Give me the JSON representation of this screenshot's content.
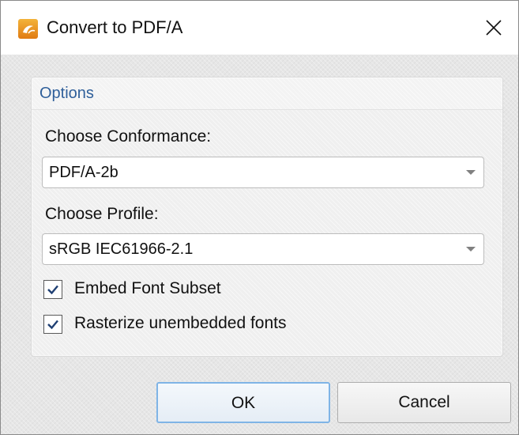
{
  "window": {
    "title": "Convert to PDF/A",
    "app_icon": "pdf-app-icon",
    "close_icon": "close-icon"
  },
  "options": {
    "group_title": "Options",
    "conformance_label": "Choose Conformance:",
    "conformance_value": "PDF/A-2b",
    "profile_label": "Choose Profile:",
    "profile_value": "sRGB IEC61966-2.1",
    "embed_font_subset_label": "Embed Font Subset",
    "embed_font_subset_checked": true,
    "rasterize_label": "Rasterize unembedded fonts",
    "rasterize_checked": true
  },
  "buttons": {
    "ok_label": "OK",
    "cancel_label": "Cancel"
  },
  "colors": {
    "group_title": "#2f5f9a",
    "ok_focus_border": "#7fb4e6",
    "app_icon": "#e07b12"
  }
}
